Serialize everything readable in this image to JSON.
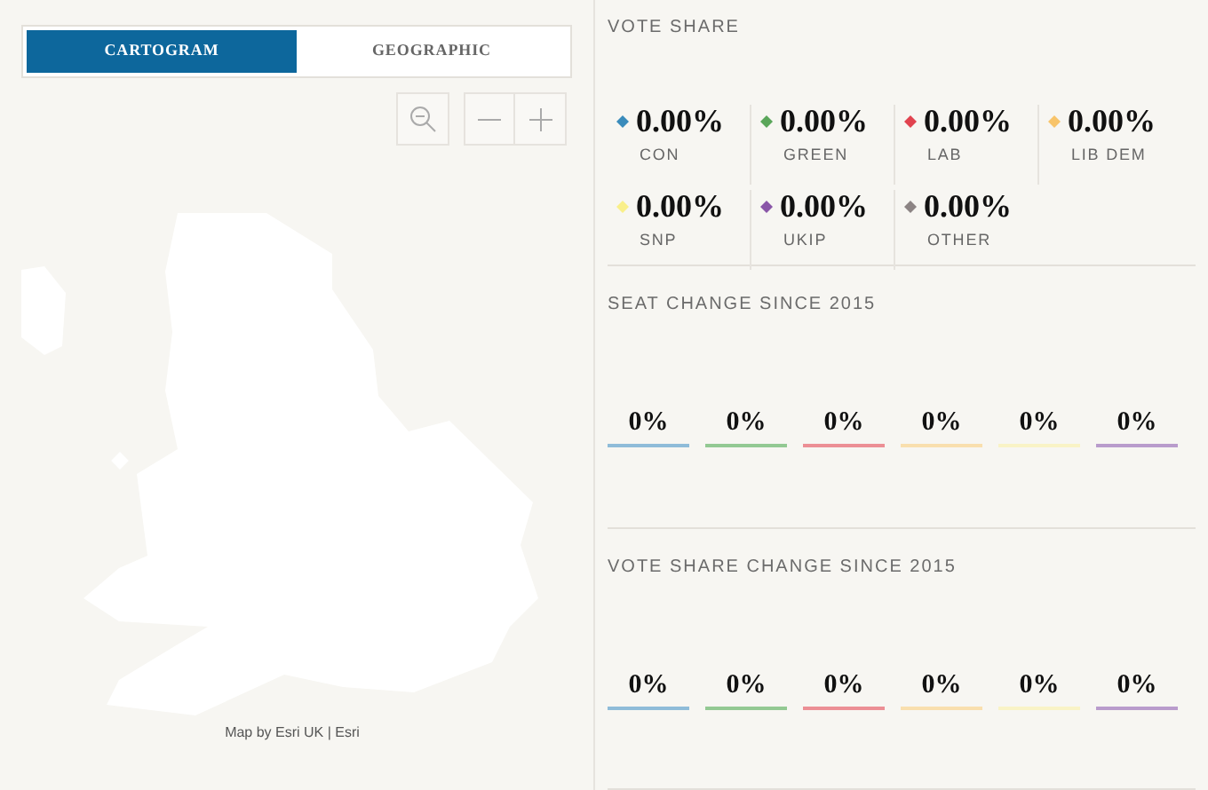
{
  "map_view_tabs": [
    {
      "label": "CARTOGRAM",
      "selected": true
    },
    {
      "label": "GEOGRAPHIC",
      "selected": false
    }
  ],
  "attribution": "Map by Esri UK | Esri",
  "vote_share": {
    "title": "VOTE SHARE",
    "parties": [
      {
        "value": "0.00%",
        "name": "CON",
        "color": "#3a8bbb"
      },
      {
        "value": "0.00%",
        "name": "GREEN",
        "color": "#5aa65a"
      },
      {
        "value": "0.00%",
        "name": "LAB",
        "color": "#e1434f"
      },
      {
        "value": "0.00%",
        "name": "LIB DEM",
        "color": "#f8c46a"
      },
      {
        "value": "0.00%",
        "name": "SNP",
        "color": "#f9ef8a"
      },
      {
        "value": "0.00%",
        "name": "UKIP",
        "color": "#8a56a8"
      },
      {
        "value": "0.00%",
        "name": "OTHER",
        "color": "#8c8484"
      }
    ]
  },
  "seat_change": {
    "title": "SEAT CHANGE SINCE 2015",
    "items": [
      {
        "value": "0%",
        "color": "#8fbcd9"
      },
      {
        "value": "0%",
        "color": "#93c993"
      },
      {
        "value": "0%",
        "color": "#ec8f95"
      },
      {
        "value": "0%",
        "color": "#f9dfae"
      },
      {
        "value": "0%",
        "color": "#f9f3c6"
      },
      {
        "value": "0%",
        "color": "#b99ccc"
      }
    ]
  },
  "vote_share_change": {
    "title": "VOTE SHARE CHANGE SINCE 2015",
    "items": [
      {
        "value": "0%",
        "color": "#8fbcd9"
      },
      {
        "value": "0%",
        "color": "#93c993"
      },
      {
        "value": "0%",
        "color": "#ec8f95"
      },
      {
        "value": "0%",
        "color": "#f9dfae"
      },
      {
        "value": "0%",
        "color": "#f9f3c6"
      },
      {
        "value": "0%",
        "color": "#b99ccc"
      }
    ]
  }
}
